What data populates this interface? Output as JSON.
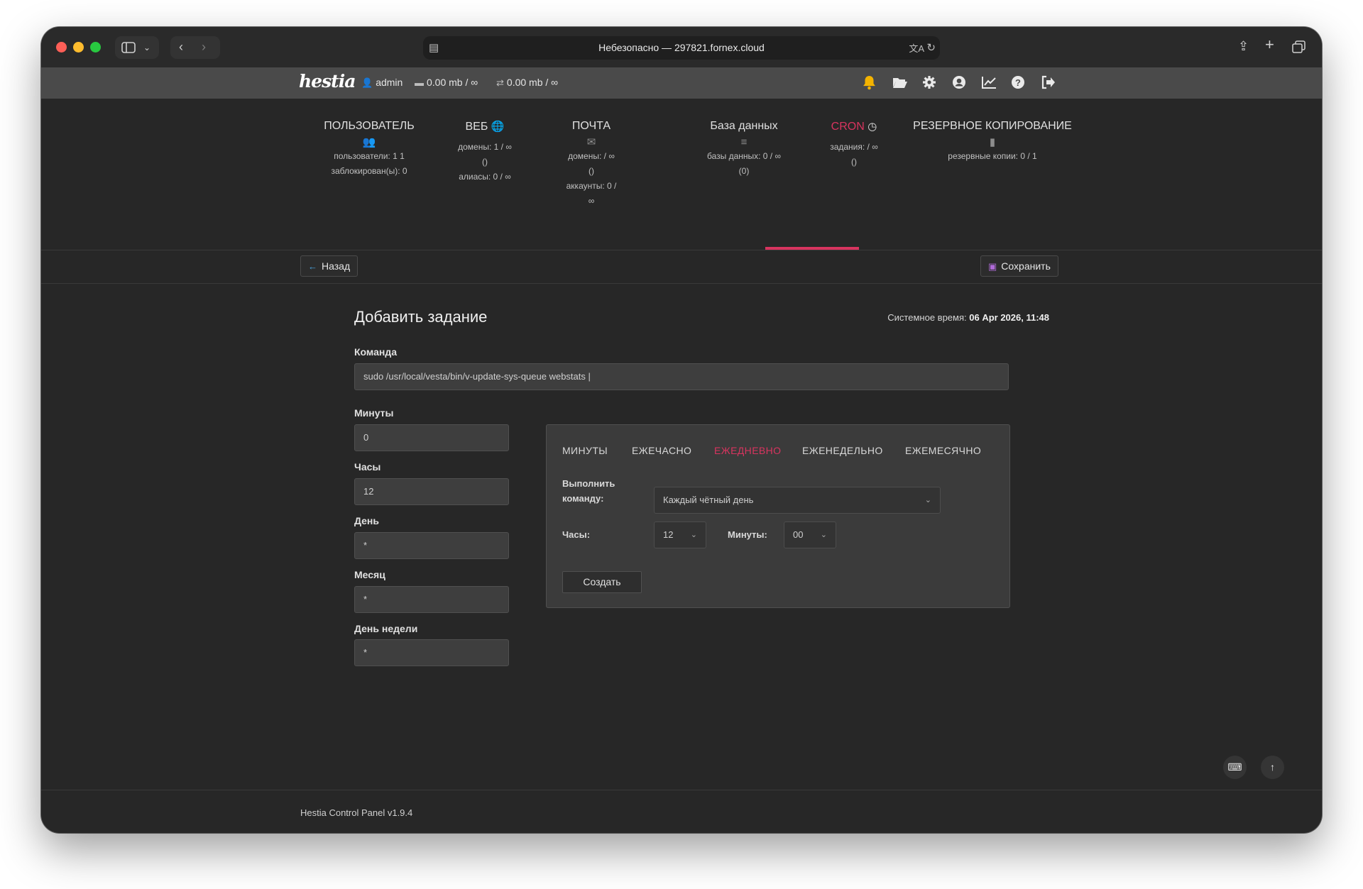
{
  "browser": {
    "address": "Небезопасно — 297821.fornex.cloud"
  },
  "topbar": {
    "logo": "hestia",
    "user": "admin",
    "disk": "0.00 mb / ∞",
    "bandwidth": "0.00 mb / ∞",
    "icons": [
      "bell-icon",
      "folder-icon",
      "gear-icon",
      "user-circle-icon",
      "chart-icon",
      "help-icon",
      "logout-icon"
    ]
  },
  "tabs": {
    "user": {
      "title": "ПОЛЬЗОВАТЕЛЬ",
      "line1": "пользователи: 1 1",
      "line2": "заблокирован(ы): 0"
    },
    "web": {
      "title": "ВЕБ",
      "line1": "домены: 1 / ∞",
      "line2": "()",
      "line3": "алиасы: 0 / ∞"
    },
    "mail": {
      "title": "ПОЧТА",
      "line1": "домены: / ∞",
      "line2": "()",
      "line3": "аккаунты: 0 /",
      "line4": "∞"
    },
    "db": {
      "title": "База данных",
      "line1": "базы данных: 0 / ∞",
      "line2": "(0)"
    },
    "cron": {
      "title": "CRON",
      "line1": "задания: / ∞",
      "line2": "()"
    },
    "backup": {
      "title": "РЕЗЕРВНОЕ КОПИРОВАНИЕ",
      "line1": "резервные копии: 0 / 1"
    }
  },
  "toolbar": {
    "back": "Назад",
    "save": "Сохранить"
  },
  "form": {
    "title": "Добавить задание",
    "systime_label": "Системное время:",
    "systime_value": "06 Apr 2026, 11:48",
    "command_label": "Команда",
    "command_value": "sudo /usr/local/vesta/bin/v-update-sys-queue webstats |",
    "minutes_label": "Минуты",
    "minutes_value": "0",
    "hours_label": "Часы",
    "hours_value": "12",
    "day_label": "День",
    "day_value": "*",
    "month_label": "Месяц",
    "month_value": "*",
    "weekday_label": "День недели",
    "weekday_value": "*"
  },
  "generator": {
    "tabs": [
      "МИНУТЫ",
      "ЕЖЕЧАСНО",
      "ЕЖЕДНЕВНО",
      "ЕЖЕНЕДЕЛЬНО",
      "ЕЖЕМЕСЯЧНО"
    ],
    "active_tab": "ЕЖЕДНЕВНО",
    "run_label_1": "Выполнить",
    "run_label_2": "команду:",
    "run_value": "Каждый чётный день",
    "hours_label": "Часы:",
    "hours_value": "12",
    "minutes_label": "Минуты:",
    "minutes_value": "00",
    "create": "Создать"
  },
  "footer": "Hestia Control Panel v1.9.4",
  "colors": {
    "accent": "#d8345f",
    "bell": "#f5b400",
    "save_icon": "#b06bd8",
    "back_arrow": "#4aa3e0"
  }
}
